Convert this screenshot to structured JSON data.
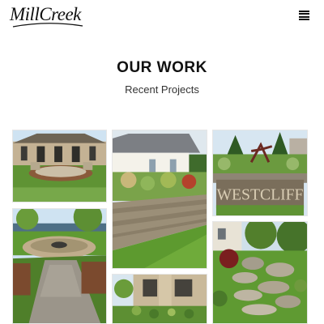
{
  "header": {
    "logo_text": "MillCreek",
    "menu_icon": "hamburger-menu-icon"
  },
  "main": {
    "title": "OUR WORK",
    "subtitle": "Recent Projects"
  },
  "gallery": {
    "items": [
      {
        "name": "patio-fire-pit-house"
      },
      {
        "name": "retaining-wall-house"
      },
      {
        "name": "westcliff-entrance-sign",
        "sign_text": "WESTCLIFF"
      },
      {
        "name": "paver-walkway-fire-pit"
      },
      {
        "name": "stone-house-garden"
      },
      {
        "name": "boulder-steps-garden"
      }
    ]
  },
  "colors": {
    "grass": "#6a9a3a",
    "sky": "#c9dff0",
    "stone": "#9a8f7c"
  }
}
